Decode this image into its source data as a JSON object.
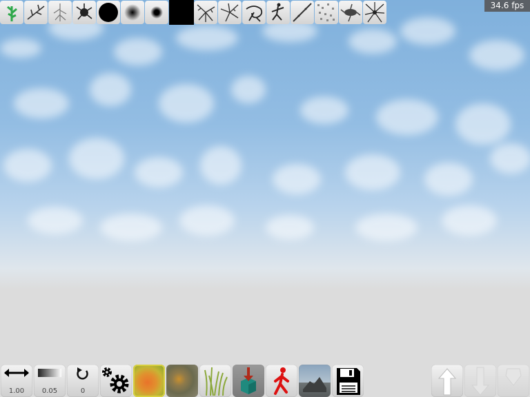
{
  "hud": {
    "fps": "34.6 fps"
  },
  "brushes": [
    {
      "name": "tree-brush-icon"
    },
    {
      "name": "branch-brush-icon"
    },
    {
      "name": "root-brush-icon"
    },
    {
      "name": "splat-brush-icon"
    },
    {
      "name": "hard-round-brush-icon"
    },
    {
      "name": "soft-round-brush-icon"
    },
    {
      "name": "small-round-brush-icon"
    },
    {
      "name": "solid-square-brush-icon"
    },
    {
      "name": "crack-brush-icon"
    },
    {
      "name": "crack-brush-2-icon"
    },
    {
      "name": "swirl-brush-icon"
    },
    {
      "name": "figure-brush-icon"
    },
    {
      "name": "line-brush-icon"
    },
    {
      "name": "noise-brush-icon"
    },
    {
      "name": "splatter-brush-icon"
    },
    {
      "name": "spider-brush-icon"
    }
  ],
  "tools": {
    "size_value": "1.00",
    "opacity_value": "0.05",
    "rotation_value": "0"
  }
}
